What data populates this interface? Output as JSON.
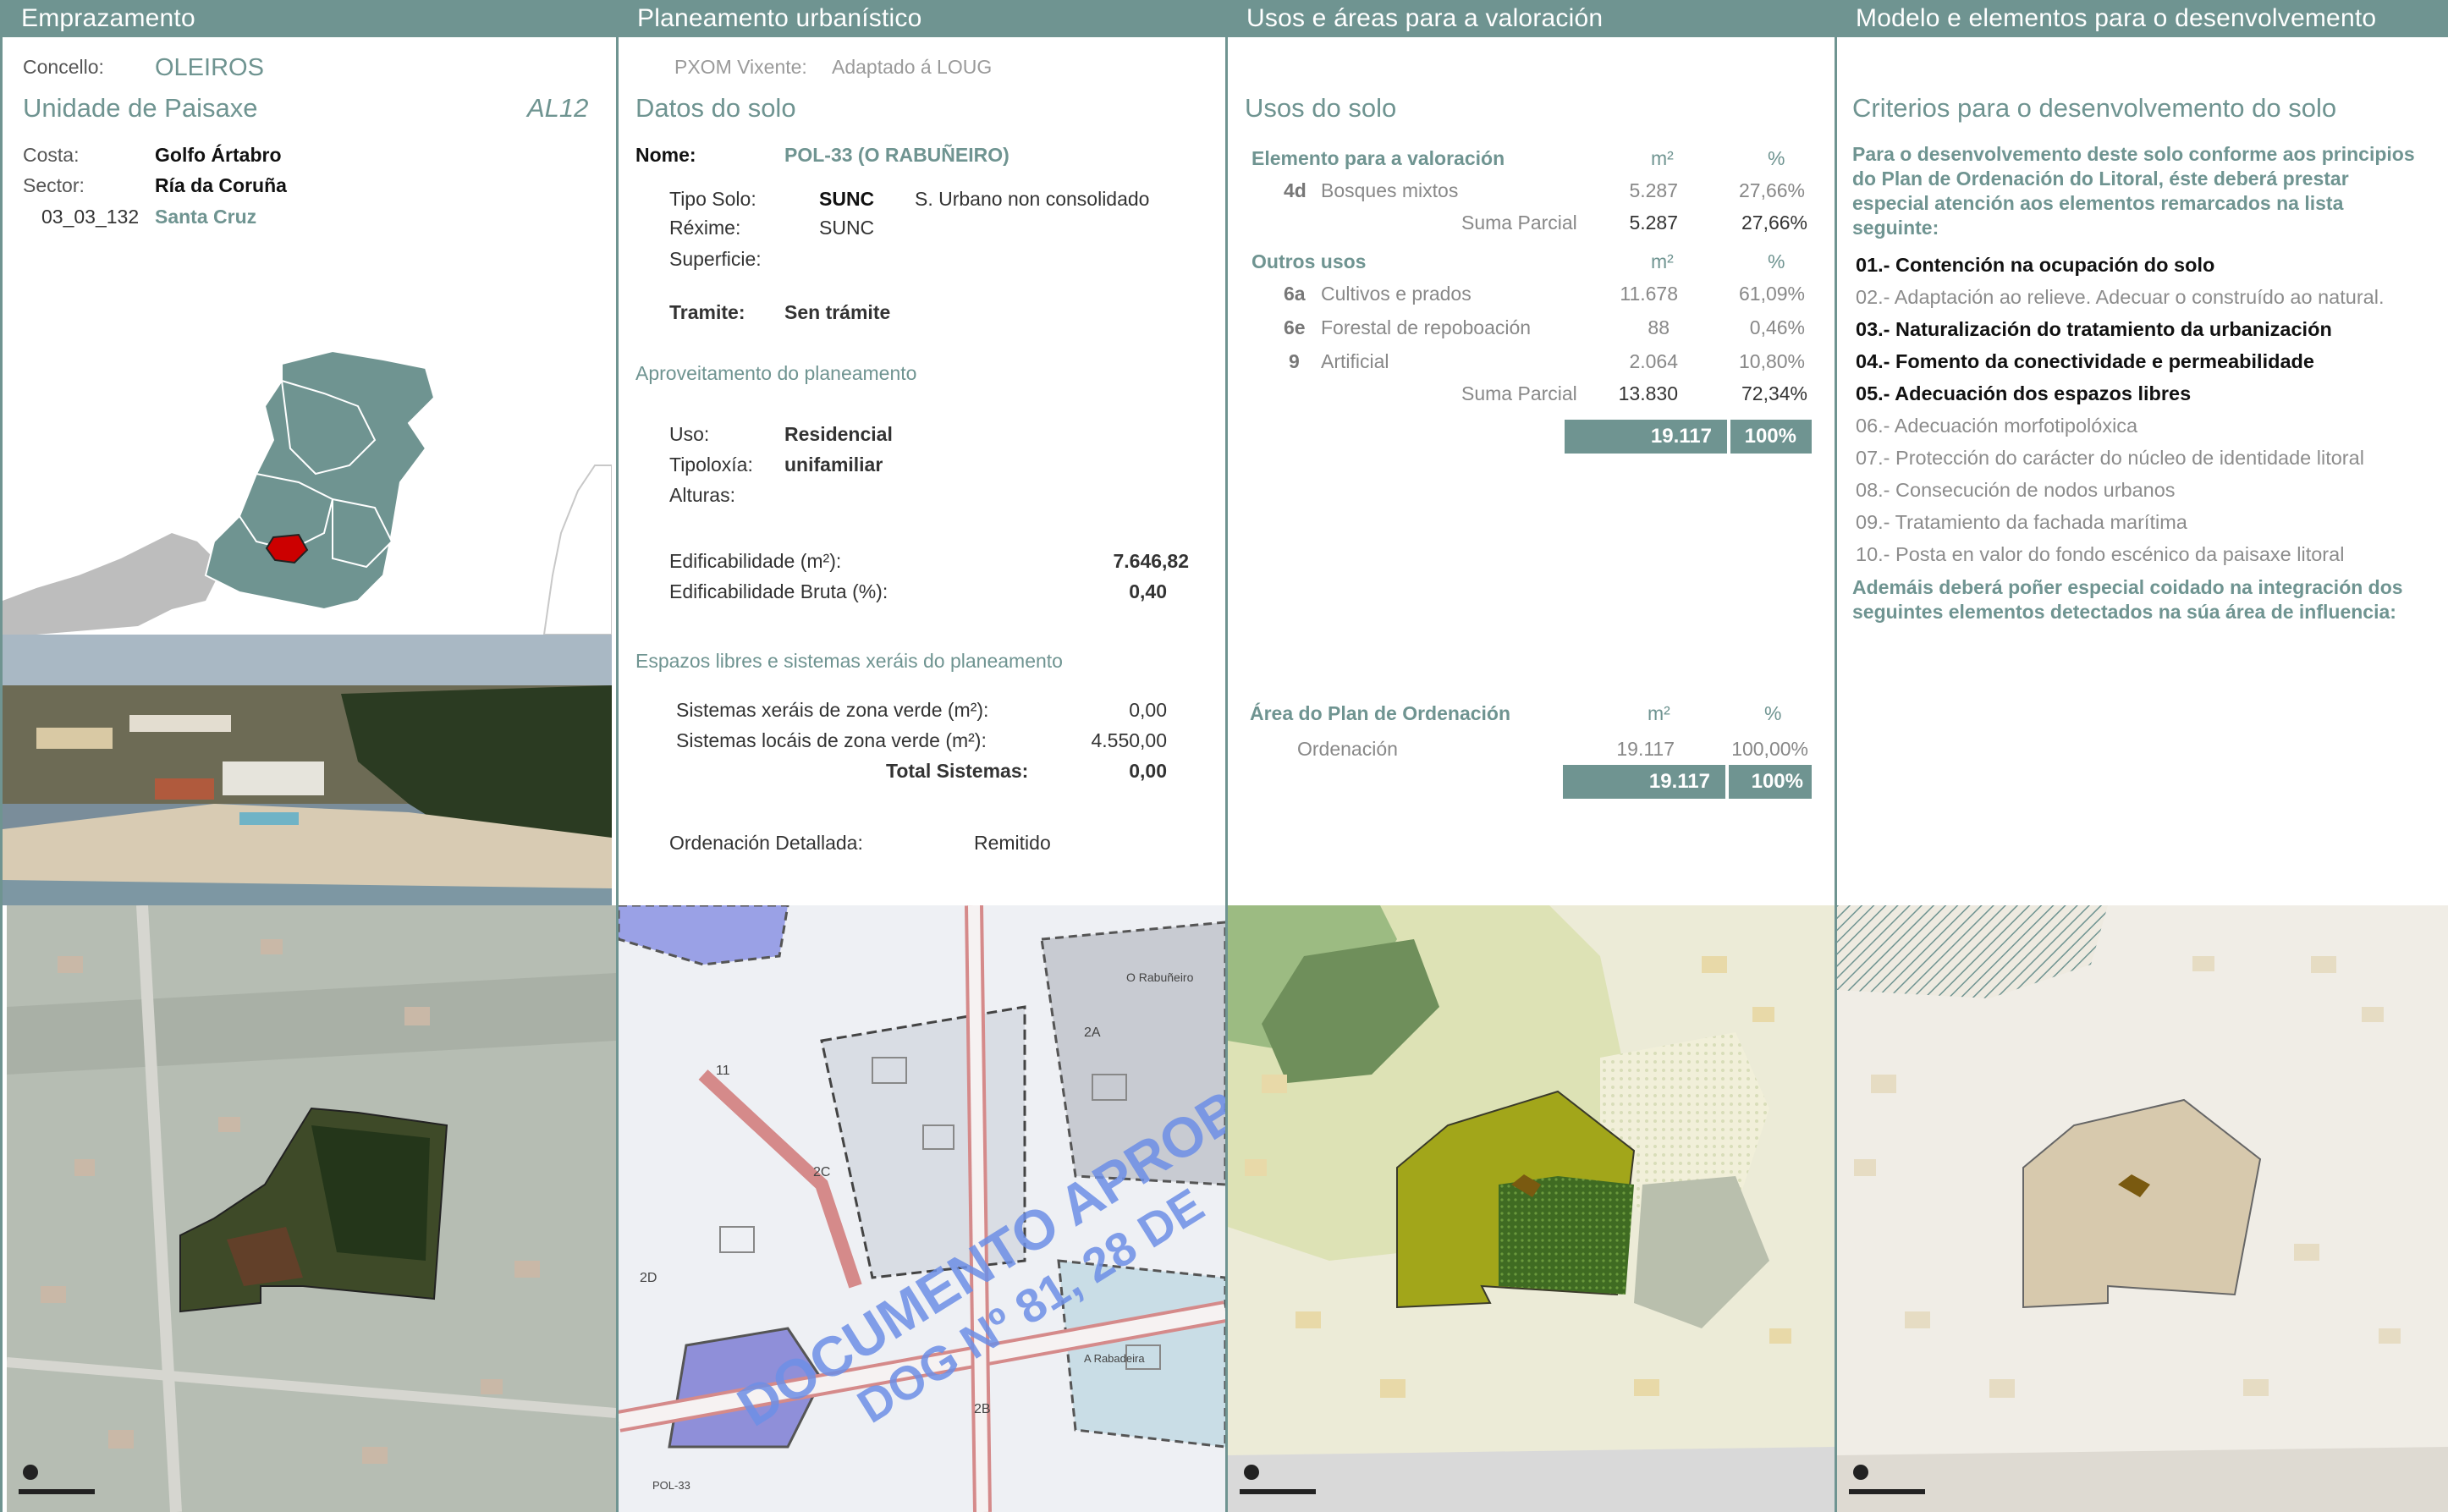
{
  "columns": {
    "c1": "Emprazamento",
    "c2": "Planeamento urbanístico",
    "c3": "Usos e áreas para a valoración",
    "c4": "Modelo e elementos para o desenvolvemento"
  },
  "emprazamento": {
    "concello_label": "Concello:",
    "concello_value": "OLEIROS",
    "unidade_label": "Unidade de Paisaxe",
    "unidade_code": "AL12",
    "costa_label": "Costa:",
    "costa_value": "Golfo Ártabro",
    "sector_label": "Sector:",
    "sector_value": "Ría da Coruña",
    "code": "03_03_132",
    "code_name": "Santa Cruz"
  },
  "planeamento": {
    "pxom_label": "PXOM Vixente:",
    "pxom_value": "Adaptado á LOUG",
    "datos_title": "Datos do solo",
    "nome_label": "Nome:",
    "nome_value": "POL-33 (O RABUÑEIRO)",
    "tipo_label": "Tipo Solo:",
    "tipo_code": "SUNC",
    "tipo_desc": "S. Urbano non consolidado",
    "rexime_label": "Réxime:",
    "rexime_value": "SUNC",
    "superficie_label": "Superficie:",
    "tramite_label": "Tramite:",
    "tramite_value": "Sen trámite",
    "aprov_title": "Aproveitamento do planeamento",
    "uso_label": "Uso:",
    "uso_value": "Residencial",
    "tipoloxia_label": "Tipoloxía:",
    "tipoloxia_value": "unifamiliar",
    "alturas_label": "Alturas:",
    "edif_label": "Edificabilidade (m²):",
    "edif_value": "7.646,82",
    "edif_bruta_label": "Edificabilidade Bruta (%):",
    "edif_bruta_value": "0,40",
    "espazos_title": "Espazos libres e sistemas xeráis do planeamento",
    "sx_label": "Sistemas xeráis de zona verde (m²):",
    "sx_value": "0,00",
    "sl_label": "Sistemas locáis de zona verde (m²):",
    "sl_value": "4.550,00",
    "total_label": "Total Sistemas:",
    "total_value": "0,00",
    "ordenacion_label": "Ordenación Detallada:",
    "ordenacion_value": "Remitido",
    "stamp_line1": "DOCUMENTO APROBADO",
    "stamp_line2": "DOG Nº 81, 28 DE"
  },
  "usos": {
    "title": "Usos do solo",
    "elem_header": "Elemento para a valoración",
    "m2_header": "m²",
    "pct_header": "%",
    "elem_rows": [
      {
        "code": "4d",
        "name": "Bosques mixtos",
        "m2": "5.287",
        "pct": "27,66%"
      }
    ],
    "suma_label": "Suma Parcial",
    "elem_suma_m2": "5.287",
    "elem_suma_pct": "27,66%",
    "outros_header": "Outros usos",
    "outros_rows": [
      {
        "code": "6a",
        "name": "Cultivos e prados",
        "m2": "11.678",
        "pct": "61,09%"
      },
      {
        "code": "6e",
        "name": "Forestal de repoboación",
        "m2": "88",
        "pct": "0,46%"
      },
      {
        "code": "9",
        "name": "Artificial",
        "m2": "2.064",
        "pct": "10,80%"
      }
    ],
    "outros_suma_m2": "13.830",
    "outros_suma_pct": "72,34%",
    "total_m2": "19.117",
    "total_pct": "100%",
    "area_header": "Área do Plan de Ordenación",
    "ordenacion_row": {
      "name": "Ordenación",
      "m2": "19.117",
      "pct": "100,00%"
    },
    "area_total_m2": "19.117",
    "area_total_pct": "100%"
  },
  "modelo": {
    "title": "Criterios para o desenvolvemento do solo",
    "intro": "Para o desenvolvemento deste solo conforme aos principios do Plan de Ordenación do Litoral, éste deberá prestar especial atención aos elementos remarcados na lista seguinte:",
    "criterios": [
      {
        "text": "01.- Contención na ocupación do solo",
        "bold": true
      },
      {
        "text": "02.- Adaptación ao relieve. Adecuar o construído ao natural.",
        "bold": false
      },
      {
        "text": "03.- Naturalización do tratamiento da urbanización",
        "bold": true
      },
      {
        "text": "04.- Fomento da conectividade e permeabilidade",
        "bold": true
      },
      {
        "text": "05.- Adecuación dos espazos libres",
        "bold": true
      },
      {
        "text": "06.- Adecuación morfotipolóxica",
        "bold": false
      },
      {
        "text": "07.- Protección do carácter do núcleo de identidade litoral",
        "bold": false
      },
      {
        "text": "08.- Consecución de nodos urbanos",
        "bold": false
      },
      {
        "text": "09.- Tratamiento da fachada marítima",
        "bold": false
      },
      {
        "text": "10.- Posta en valor do fondo escénico da paisaxe litoral",
        "bold": false
      }
    ],
    "ademais": "Ademáis deberá poñer especial coidado na integración dos seguintes elementos detectados na súa área de influencia:"
  },
  "map_labels": {
    "rabuneiro": "O Rabuñeiro",
    "zone_2a": "2A",
    "zone_2b": "2B",
    "zone_2c": "2C",
    "zone_2d": "2D",
    "zone_11": "11",
    "rabadeira": "A Rabadeira",
    "pol": "POL-33"
  },
  "colors": {
    "accent": "#6f9491",
    "selected_region": "#cc0000",
    "plot_green": "#a2a61a",
    "forest": "#3f6b22"
  }
}
